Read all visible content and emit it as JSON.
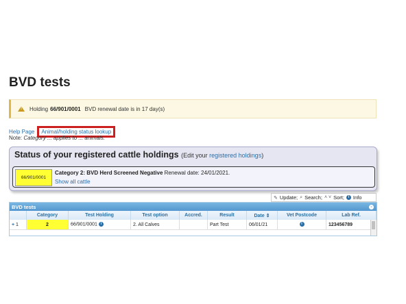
{
  "page": {
    "title": "BVD tests"
  },
  "warning": {
    "label": "Holding",
    "holding": "66/901/0001",
    "message": "BVD renewal date is in 17 day(s)"
  },
  "links": {
    "help": "Help Page",
    "lookup": "Animal/holding status lookup"
  },
  "note": {
    "prefix": "Note:",
    "text": "Category ... applies to ... animals."
  },
  "status_panel": {
    "title": "Status of your registered cattle holdings",
    "edit_prefix": "(Edit your",
    "edit_link": "registered holdings",
    "edit_suffix": ")",
    "holding": "66/901/0001",
    "category": "Category 2: BVD Herd Screened Negative",
    "renewal": "Renewal date: 24/01/2021.",
    "show_all": "Show all cattle",
    "highlight_color": "#ffff33"
  },
  "toolbar": {
    "update": "Update;",
    "search": "Search;",
    "sort": "Sort;",
    "info": "Info"
  },
  "grid": {
    "title": "BVD tests",
    "columns": [
      "",
      "Category",
      "Test Holding",
      "Test option",
      "Accred.",
      "Result",
      "Date",
      "Vet Postcode",
      "Lab Ref."
    ],
    "rows": [
      {
        "expand": "+",
        "num": "1",
        "category": "2",
        "holding": "66/901/0001",
        "option": "2. All Calves",
        "accred": "",
        "result": "Part Test",
        "date": "06/01/21",
        "vet": "",
        "lab": "123456789"
      }
    ]
  },
  "colors": {
    "accent": "#2a6ea8",
    "warning_bg": "#fcf8e3",
    "highlight_box": "#cc1f1f",
    "grid_header": "#5598cf"
  }
}
